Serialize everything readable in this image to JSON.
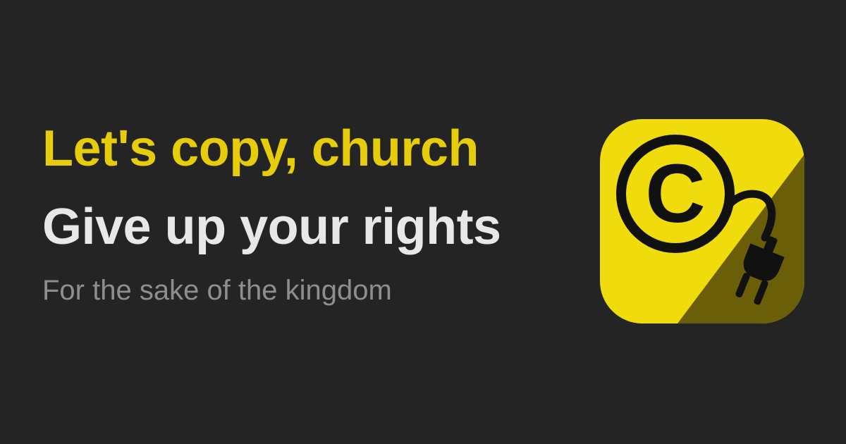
{
  "headline": {
    "line1": "Let's copy, church",
    "line2": "Give up your rights"
  },
  "tagline": "For the sake of the kingdom",
  "colors": {
    "background": "#242424",
    "accent": "#e6cc0a",
    "headline_secondary": "#e8e8e8",
    "tagline": "#8e8e8e",
    "logo_yellow": "#f0dc0c",
    "logo_shade": "#6b5e08",
    "logo_ink": "#111111"
  },
  "logo": {
    "icon": "copyright-unplugged-icon",
    "glyph": "C"
  }
}
